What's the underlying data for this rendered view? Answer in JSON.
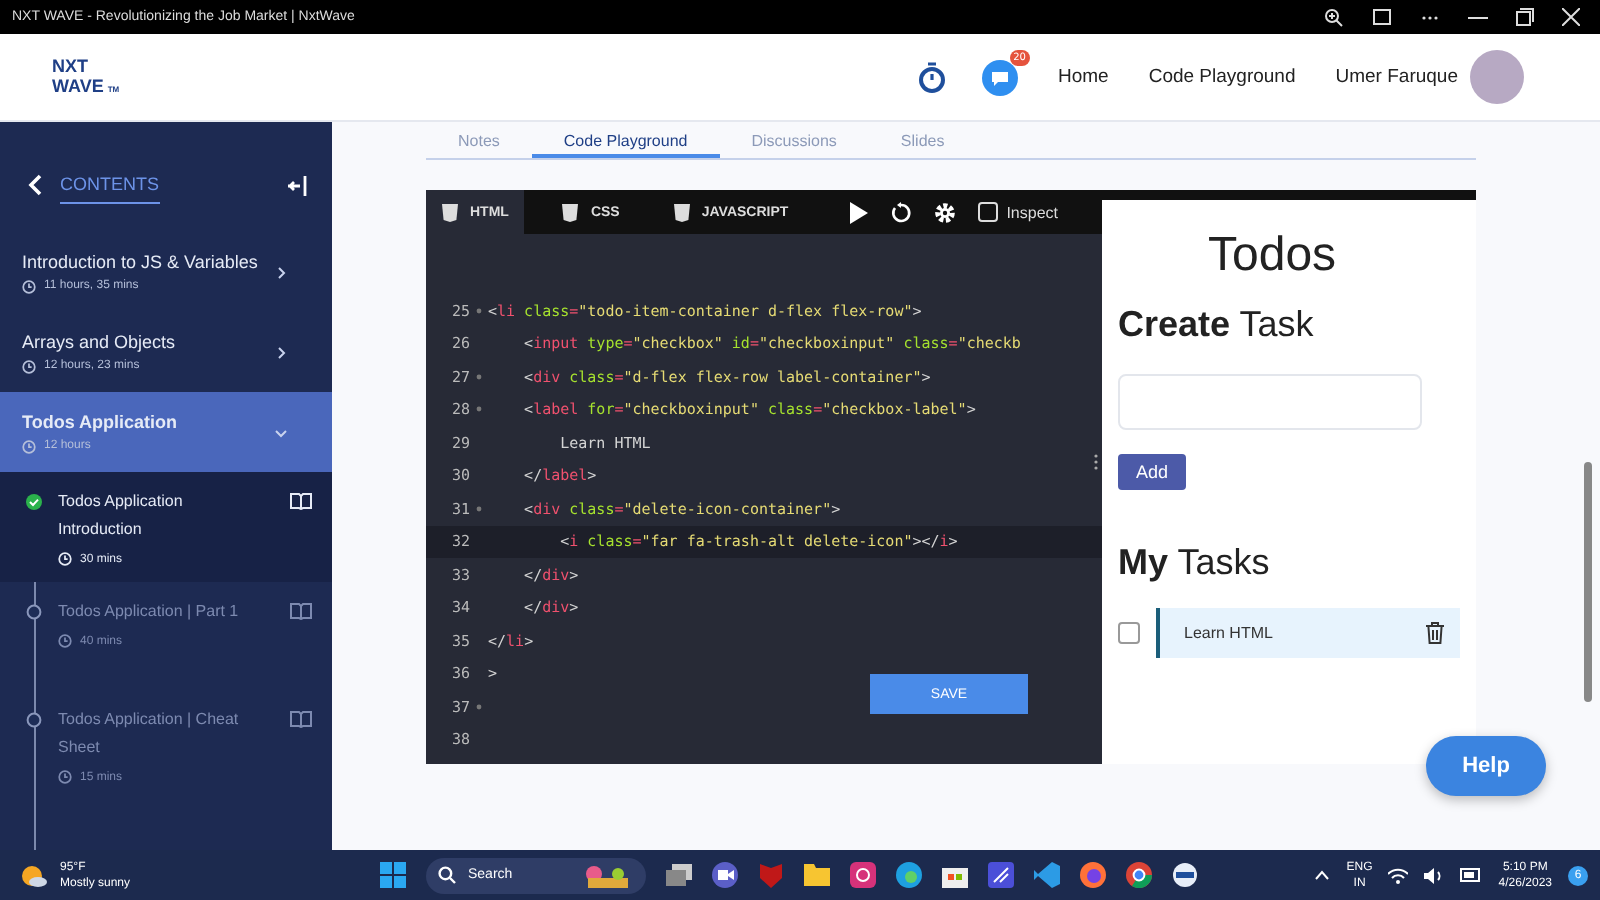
{
  "window": {
    "title": "NXT WAVE - Revolutionizing the Job Market | NxtWave"
  },
  "header": {
    "logo_line1": "NXT",
    "logo_line2": "WAVE",
    "logo_mark": "TM",
    "chat_badge": "20",
    "nav": [
      "Home",
      "Code Playground"
    ],
    "user": "Umer Faruque"
  },
  "sidebar": {
    "title": "CONTENTS",
    "modules": [
      {
        "title": "Introduction to JS & Variables",
        "duration": "11 hours, 35 mins",
        "selected": false,
        "expanded": false
      },
      {
        "title": "Arrays and Objects",
        "duration": "12 hours, 23 mins",
        "selected": false,
        "expanded": false
      },
      {
        "title": "Todos Application",
        "duration": "12 hours",
        "selected": true,
        "expanded": true
      }
    ],
    "units": [
      {
        "title": "Todos Application Introduction",
        "duration": "30 mins",
        "completed": true,
        "selected": true
      },
      {
        "title": "Todos Application | Part 1",
        "duration": "40 mins",
        "completed": false,
        "selected": false
      },
      {
        "title": "Todos Application | Cheat Sheet",
        "duration": "15 mins",
        "completed": false,
        "selected": false
      }
    ]
  },
  "tabs": [
    {
      "label": "Notes",
      "selected": false
    },
    {
      "label": "Code Playground",
      "selected": true
    },
    {
      "label": "Discussions",
      "selected": false
    },
    {
      "label": "Slides",
      "selected": false
    }
  ],
  "editor": {
    "files": [
      {
        "label": "HTML",
        "selected": true
      },
      {
        "label": "CSS",
        "selected": false
      },
      {
        "label": "JAVASCRIPT",
        "selected": false
      }
    ],
    "inspect": {
      "label": "Inspect",
      "checked": false
    },
    "save": "SAVE",
    "lines": [
      {
        "no": "25",
        "fold": true,
        "active": false,
        "tokens": [
          {
            "kind": "p",
            "text": "<"
          },
          {
            "kind": "tag",
            "text": "li"
          },
          {
            "kind": "attr",
            "text": " class"
          },
          {
            "kind": "tag",
            "text": "="
          },
          {
            "kind": "str",
            "text": "\"todo-item-container d-flex flex-row\""
          },
          {
            "kind": "p",
            "text": ">"
          }
        ]
      },
      {
        "no": "26",
        "fold": false,
        "active": false,
        "tokens": [
          {
            "kind": "p",
            "text": "    <"
          },
          {
            "kind": "tag",
            "text": "input"
          },
          {
            "kind": "attr",
            "text": " type"
          },
          {
            "kind": "tag",
            "text": "="
          },
          {
            "kind": "str",
            "text": "\"checkbox\""
          },
          {
            "kind": "attr",
            "text": " id"
          },
          {
            "kind": "tag",
            "text": "="
          },
          {
            "kind": "str",
            "text": "\"checkboxinput\""
          },
          {
            "kind": "attr",
            "text": " class"
          },
          {
            "kind": "tag",
            "text": "="
          },
          {
            "kind": "str",
            "text": "\"checkb"
          }
        ]
      },
      {
        "no": "27",
        "fold": true,
        "active": false,
        "tokens": [
          {
            "kind": "p",
            "text": "    <"
          },
          {
            "kind": "tag",
            "text": "div"
          },
          {
            "kind": "attr",
            "text": " class"
          },
          {
            "kind": "tag",
            "text": "="
          },
          {
            "kind": "str",
            "text": "\"d-flex flex-row label-container\""
          },
          {
            "kind": "p",
            "text": ">"
          }
        ]
      },
      {
        "no": "28",
        "fold": true,
        "active": false,
        "tokens": [
          {
            "kind": "p",
            "text": "    <"
          },
          {
            "kind": "tag",
            "text": "label"
          },
          {
            "kind": "attr",
            "text": " for"
          },
          {
            "kind": "tag",
            "text": "="
          },
          {
            "kind": "str",
            "text": "\"checkboxinput\""
          },
          {
            "kind": "attr",
            "text": " class"
          },
          {
            "kind": "tag",
            "text": "="
          },
          {
            "kind": "str",
            "text": "\"checkbox-label\""
          },
          {
            "kind": "p",
            "text": ">"
          }
        ]
      },
      {
        "no": "29",
        "fold": false,
        "active": false,
        "tokens": [
          {
            "kind": "p",
            "text": "        Learn HTML"
          }
        ]
      },
      {
        "no": "30",
        "fold": false,
        "active": false,
        "tokens": [
          {
            "kind": "p",
            "text": "    </"
          },
          {
            "kind": "tag",
            "text": "label"
          },
          {
            "kind": "p",
            "text": ">"
          }
        ]
      },
      {
        "no": "31",
        "fold": true,
        "active": false,
        "tokens": [
          {
            "kind": "p",
            "text": "    <"
          },
          {
            "kind": "tag",
            "text": "div"
          },
          {
            "kind": "attr",
            "text": " class"
          },
          {
            "kind": "tag",
            "text": "="
          },
          {
            "kind": "str",
            "text": "\"delete-icon-container\""
          },
          {
            "kind": "p",
            "text": ">"
          }
        ]
      },
      {
        "no": "32",
        "fold": false,
        "active": true,
        "tokens": [
          {
            "kind": "p",
            "text": "        <"
          },
          {
            "kind": "tag",
            "text": "i"
          },
          {
            "kind": "attr",
            "text": " class"
          },
          {
            "kind": "tag",
            "text": "="
          },
          {
            "kind": "str",
            "text": "\"far fa-trash-alt delete-icon\""
          },
          {
            "kind": "p",
            "text": "></"
          },
          {
            "kind": "tag",
            "text": "i"
          },
          {
            "kind": "p",
            "text": ">"
          }
        ]
      },
      {
        "no": "33",
        "fold": false,
        "active": false,
        "tokens": [
          {
            "kind": "p",
            "text": "    </"
          },
          {
            "kind": "tag",
            "text": "div"
          },
          {
            "kind": "p",
            "text": ">"
          }
        ]
      },
      {
        "no": "34",
        "fold": false,
        "active": false,
        "tokens": [
          {
            "kind": "p",
            "text": "    </"
          },
          {
            "kind": "tag",
            "text": "div"
          },
          {
            "kind": "p",
            "text": ">"
          }
        ]
      },
      {
        "no": "35",
        "fold": false,
        "active": false,
        "tokens": [
          {
            "kind": "p",
            "text": "</"
          },
          {
            "kind": "tag",
            "text": "li"
          },
          {
            "kind": "p",
            "text": ">"
          }
        ]
      },
      {
        "no": "36",
        "fold": false,
        "active": false,
        "tokens": [
          {
            "kind": "p",
            "text": ">"
          }
        ]
      },
      {
        "no": "37",
        "fold": true,
        "active": false
      },
      {
        "no": "38",
        "fold": false,
        "active": false
      }
    ]
  },
  "preview": {
    "heading": "Todos",
    "create_bold": "Create",
    "create_rest": "Task",
    "add": "Add",
    "tasks_bold": "My",
    "tasks_rest": "Tasks",
    "tasks": [
      {
        "label": "Learn HTML",
        "checked": false
      }
    ]
  },
  "help": "Help",
  "taskbar": {
    "temp": "95°F",
    "weather": "Mostly sunny",
    "search": "Search",
    "lang": "ENG",
    "region": "IN",
    "time": "5:10 PM",
    "date": "4/26/2023",
    "notifications": "6"
  }
}
